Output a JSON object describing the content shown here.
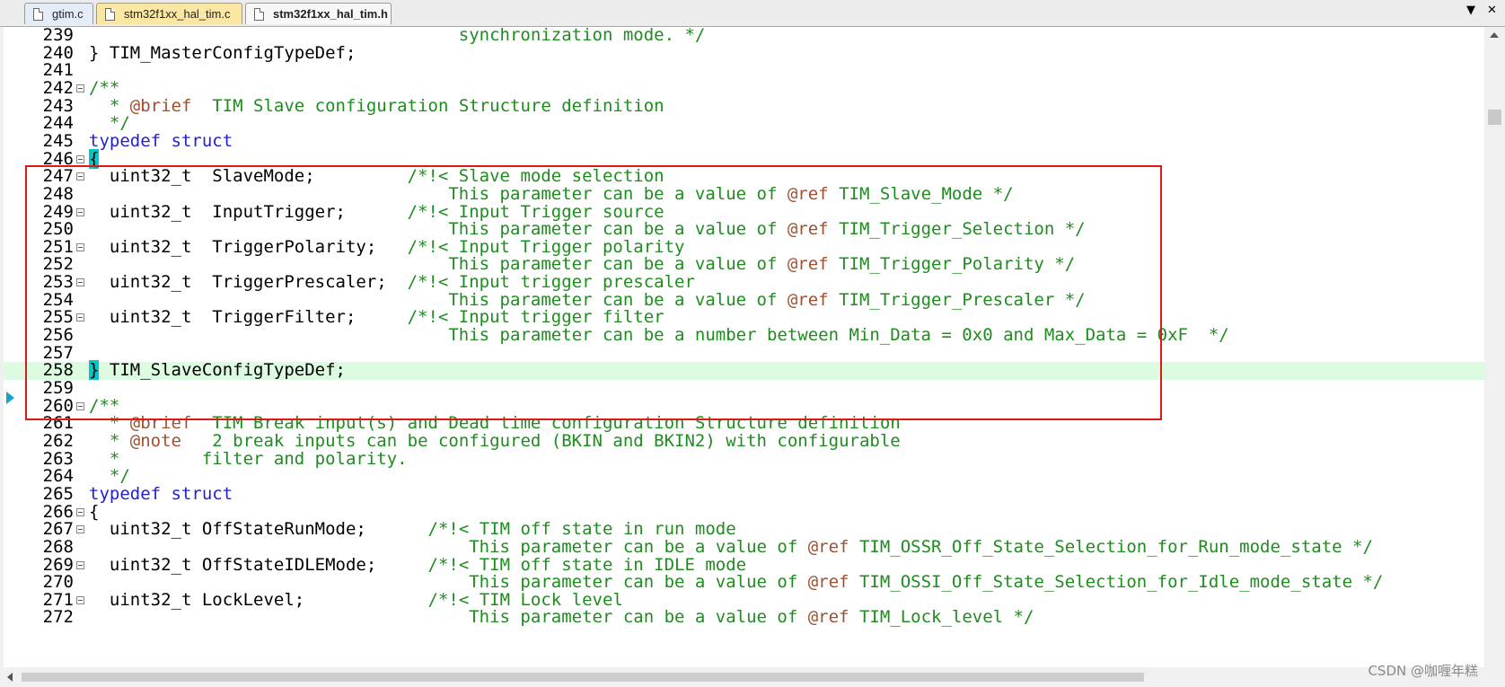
{
  "tabs": [
    {
      "label": "gtim.c"
    },
    {
      "label": "stm32f1xx_hal_tim.c"
    },
    {
      "label": "stm32f1xx_hal_tim.h",
      "active": true
    }
  ],
  "tab_controls": {
    "dropdown": "▼",
    "close": "✕"
  },
  "lines": [
    {
      "n": "239",
      "fold": false,
      "parts": [
        [
          "cm",
          "                                    synchronization mode. */"
        ]
      ]
    },
    {
      "n": "240",
      "fold": false,
      "parts": [
        [
          "t",
          "} TIM_MasterConfigTypeDef;"
        ]
      ]
    },
    {
      "n": "241",
      "fold": false,
      "parts": [
        [
          "t",
          ""
        ]
      ]
    },
    {
      "n": "242",
      "fold": true,
      "parts": [
        [
          "cm",
          "/**"
        ]
      ]
    },
    {
      "n": "243",
      "fold": false,
      "parts": [
        [
          "cm",
          "  * "
        ],
        [
          "tag",
          "@brief"
        ],
        [
          "cm",
          "  TIM Slave configuration Structure definition"
        ]
      ]
    },
    {
      "n": "244",
      "fold": false,
      "parts": [
        [
          "cm",
          "  */"
        ]
      ]
    },
    {
      "n": "245",
      "fold": false,
      "parts": [
        [
          "kw",
          "typedef struct"
        ]
      ]
    },
    {
      "n": "246",
      "fold": true,
      "parts": [
        [
          "brace",
          "{"
        ]
      ]
    },
    {
      "n": "247",
      "fold": true,
      "parts": [
        [
          "t",
          "  uint32_t  SlaveMode;         "
        ],
        [
          "cm",
          "/*!< Slave mode selection"
        ]
      ]
    },
    {
      "n": "248",
      "fold": false,
      "parts": [
        [
          "cm",
          "                                   This parameter can be a value of "
        ],
        [
          "tag",
          "@ref"
        ],
        [
          "cm",
          " TIM_Slave_Mode */"
        ]
      ]
    },
    {
      "n": "249",
      "fold": true,
      "parts": [
        [
          "t",
          "  uint32_t  InputTrigger;      "
        ],
        [
          "cm",
          "/*!< Input Trigger source"
        ]
      ]
    },
    {
      "n": "250",
      "fold": false,
      "parts": [
        [
          "cm",
          "                                   This parameter can be a value of "
        ],
        [
          "tag",
          "@ref"
        ],
        [
          "cm",
          " TIM_Trigger_Selection */"
        ]
      ]
    },
    {
      "n": "251",
      "fold": true,
      "parts": [
        [
          "t",
          "  uint32_t  TriggerPolarity;   "
        ],
        [
          "cm",
          "/*!< Input Trigger polarity"
        ]
      ]
    },
    {
      "n": "252",
      "fold": false,
      "parts": [
        [
          "cm",
          "                                   This parameter can be a value of "
        ],
        [
          "tag",
          "@ref"
        ],
        [
          "cm",
          " TIM_Trigger_Polarity */"
        ]
      ]
    },
    {
      "n": "253",
      "fold": true,
      "parts": [
        [
          "t",
          "  uint32_t  TriggerPrescaler;  "
        ],
        [
          "cm",
          "/*!< Input trigger prescaler"
        ]
      ]
    },
    {
      "n": "254",
      "fold": false,
      "parts": [
        [
          "cm",
          "                                   This parameter can be a value of "
        ],
        [
          "tag",
          "@ref"
        ],
        [
          "cm",
          " TIM_Trigger_Prescaler */"
        ]
      ]
    },
    {
      "n": "255",
      "fold": true,
      "parts": [
        [
          "t",
          "  uint32_t  TriggerFilter;     "
        ],
        [
          "cm",
          "/*!< Input trigger filter"
        ]
      ]
    },
    {
      "n": "256",
      "fold": false,
      "parts": [
        [
          "cm",
          "                                   This parameter can be a number between Min_Data = 0x0 and Max_Data = 0xF  */"
        ]
      ]
    },
    {
      "n": "257",
      "fold": false,
      "parts": [
        [
          "t",
          ""
        ]
      ]
    },
    {
      "n": "258",
      "fold": false,
      "current": true,
      "parts": [
        [
          "brace",
          "}"
        ],
        [
          "t",
          " TIM_SlaveConfigTypeDef;"
        ]
      ]
    },
    {
      "n": "259",
      "fold": false,
      "parts": [
        [
          "t",
          ""
        ]
      ]
    },
    {
      "n": "260",
      "fold": true,
      "parts": [
        [
          "cm",
          "/**"
        ]
      ]
    },
    {
      "n": "261",
      "fold": false,
      "parts": [
        [
          "cm",
          "  * "
        ],
        [
          "tag",
          "@brief"
        ],
        [
          "cm",
          "  TIM Break input(s) and Dead time configuration Structure definition"
        ]
      ]
    },
    {
      "n": "262",
      "fold": false,
      "parts": [
        [
          "cm",
          "  * "
        ],
        [
          "tag",
          "@note"
        ],
        [
          "cm",
          "   2 break inputs can be configured (BKIN and BKIN2) with configurable"
        ]
      ]
    },
    {
      "n": "263",
      "fold": false,
      "parts": [
        [
          "cm",
          "  *        filter and polarity."
        ]
      ]
    },
    {
      "n": "264",
      "fold": false,
      "parts": [
        [
          "cm",
          "  */"
        ]
      ]
    },
    {
      "n": "265",
      "fold": false,
      "parts": [
        [
          "kw",
          "typedef struct"
        ]
      ]
    },
    {
      "n": "266",
      "fold": true,
      "parts": [
        [
          "t",
          "{"
        ]
      ]
    },
    {
      "n": "267",
      "fold": true,
      "parts": [
        [
          "t",
          "  uint32_t OffStateRunMode;      "
        ],
        [
          "cm",
          "/*!< TIM off state in run mode"
        ]
      ]
    },
    {
      "n": "268",
      "fold": false,
      "parts": [
        [
          "cm",
          "                                     This parameter can be a value of "
        ],
        [
          "tag",
          "@ref"
        ],
        [
          "cm",
          " TIM_OSSR_Off_State_Selection_for_Run_mode_state */"
        ]
      ]
    },
    {
      "n": "269",
      "fold": true,
      "parts": [
        [
          "t",
          "  uint32_t OffStateIDLEMode;     "
        ],
        [
          "cm",
          "/*!< TIM off state in IDLE mode"
        ]
      ]
    },
    {
      "n": "270",
      "fold": false,
      "parts": [
        [
          "cm",
          "                                     This parameter can be a value of "
        ],
        [
          "tag",
          "@ref"
        ],
        [
          "cm",
          " TIM_OSSI_Off_State_Selection_for_Idle_mode_state */"
        ]
      ]
    },
    {
      "n": "271",
      "fold": true,
      "parts": [
        [
          "t",
          "  uint32_t LockLevel;            "
        ],
        [
          "cm",
          "/*!< TIM Lock level"
        ]
      ]
    },
    {
      "n": "272",
      "fold": false,
      "parts": [
        [
          "cm",
          "                                     This parameter can be a value of "
        ],
        [
          "tag",
          "@ref"
        ],
        [
          "cm",
          " TIM_Lock_level */"
        ]
      ]
    }
  ],
  "watermark": "CSDN @咖喱年糕"
}
